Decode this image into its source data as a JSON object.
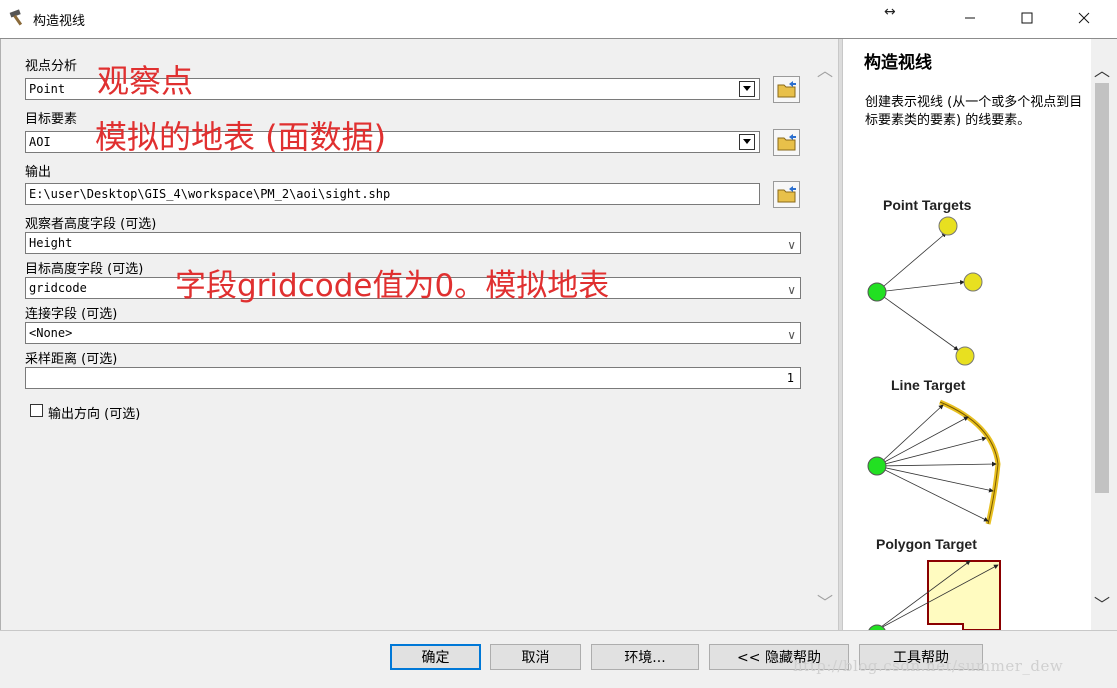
{
  "window": {
    "title": "构造视线"
  },
  "form": {
    "observer": {
      "label": "视点分析",
      "value": "Point"
    },
    "target": {
      "label": "目标要素",
      "value": "AOI"
    },
    "output": {
      "label": "输出",
      "value": "E:\\user\\Desktop\\GIS_4\\workspace\\PM_2\\aoi\\sight.shp"
    },
    "observer_height": {
      "label": "观察者高度字段 (可选)",
      "value": "Height"
    },
    "target_height": {
      "label": "目标高度字段 (可选)",
      "value": "gridcode"
    },
    "join_field": {
      "label": "连接字段 (可选)",
      "value": "<None>"
    },
    "sampling": {
      "label": "采样距离 (可选)",
      "value": "1"
    },
    "direction": {
      "label": "输出方向 (可选)",
      "checked": false
    }
  },
  "annotations": {
    "a1": "观察点",
    "a2": "模拟的地表 (面数据)",
    "a3": "字段gridcode值为0。模拟地表",
    "color": "#e03030"
  },
  "help": {
    "title": "构造视线",
    "description": "创建表示视线 (从一个或多个视点到目标要素类的要素) 的线要素。",
    "diagrams": [
      "Point Targets",
      "Line Target",
      "Polygon Target"
    ]
  },
  "buttons": {
    "ok": "确定",
    "cancel": "取消",
    "env": "环境...",
    "hide_help": "<< 隐藏帮助",
    "tool_help": "工具帮助"
  },
  "watermark": "http://blog.csdn.net/summer_dew",
  "icons": [
    "hammer-icon",
    "resize-icon",
    "minimize-icon",
    "maximize-icon",
    "close-icon",
    "folder-open-icon",
    "chevron-down-icon"
  ]
}
